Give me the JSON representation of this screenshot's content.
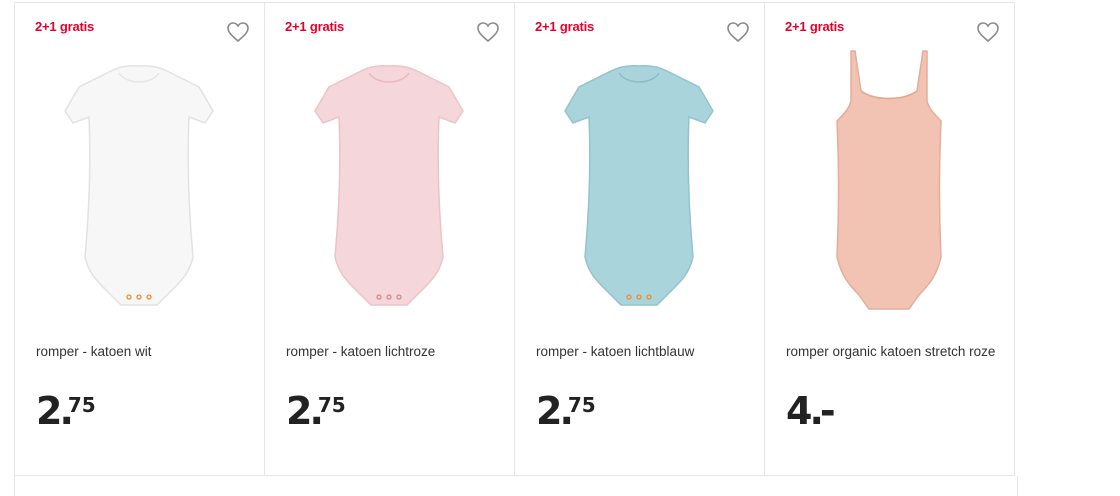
{
  "colors": {
    "badge": "#e4002b",
    "white_body": "#f7f7f7",
    "pink_body": "#f5d6da",
    "blue_body": "#a9d4dc",
    "salmon_body": "#f2c3b2",
    "snap": "#f28c28"
  },
  "products": [
    {
      "badge": "2+1 gratis",
      "title": "romper - katoen wit",
      "price_whole": "2",
      "price_dot": ".",
      "price_cents": "75",
      "image": "white-short-sleeve-bodysuit",
      "favorite_icon": "heart-outline-icon"
    },
    {
      "badge": "2+1 gratis",
      "title": "romper - katoen lichtroze",
      "price_whole": "2",
      "price_dot": ".",
      "price_cents": "75",
      "image": "light-pink-short-sleeve-bodysuit",
      "favorite_icon": "heart-outline-icon"
    },
    {
      "badge": "2+1 gratis",
      "title": "romper - katoen lichtblauw",
      "price_whole": "2",
      "price_dot": ".",
      "price_cents": "75",
      "image": "light-blue-short-sleeve-bodysuit",
      "favorite_icon": "heart-outline-icon"
    },
    {
      "badge": "2+1 gratis",
      "title": "romper organic katoen stretch roze",
      "price_whole": "4",
      "price_dot": ".",
      "price_cents": "-",
      "image": "salmon-spaghetti-strap-bodysuit",
      "favorite_icon": "heart-outline-icon"
    }
  ]
}
